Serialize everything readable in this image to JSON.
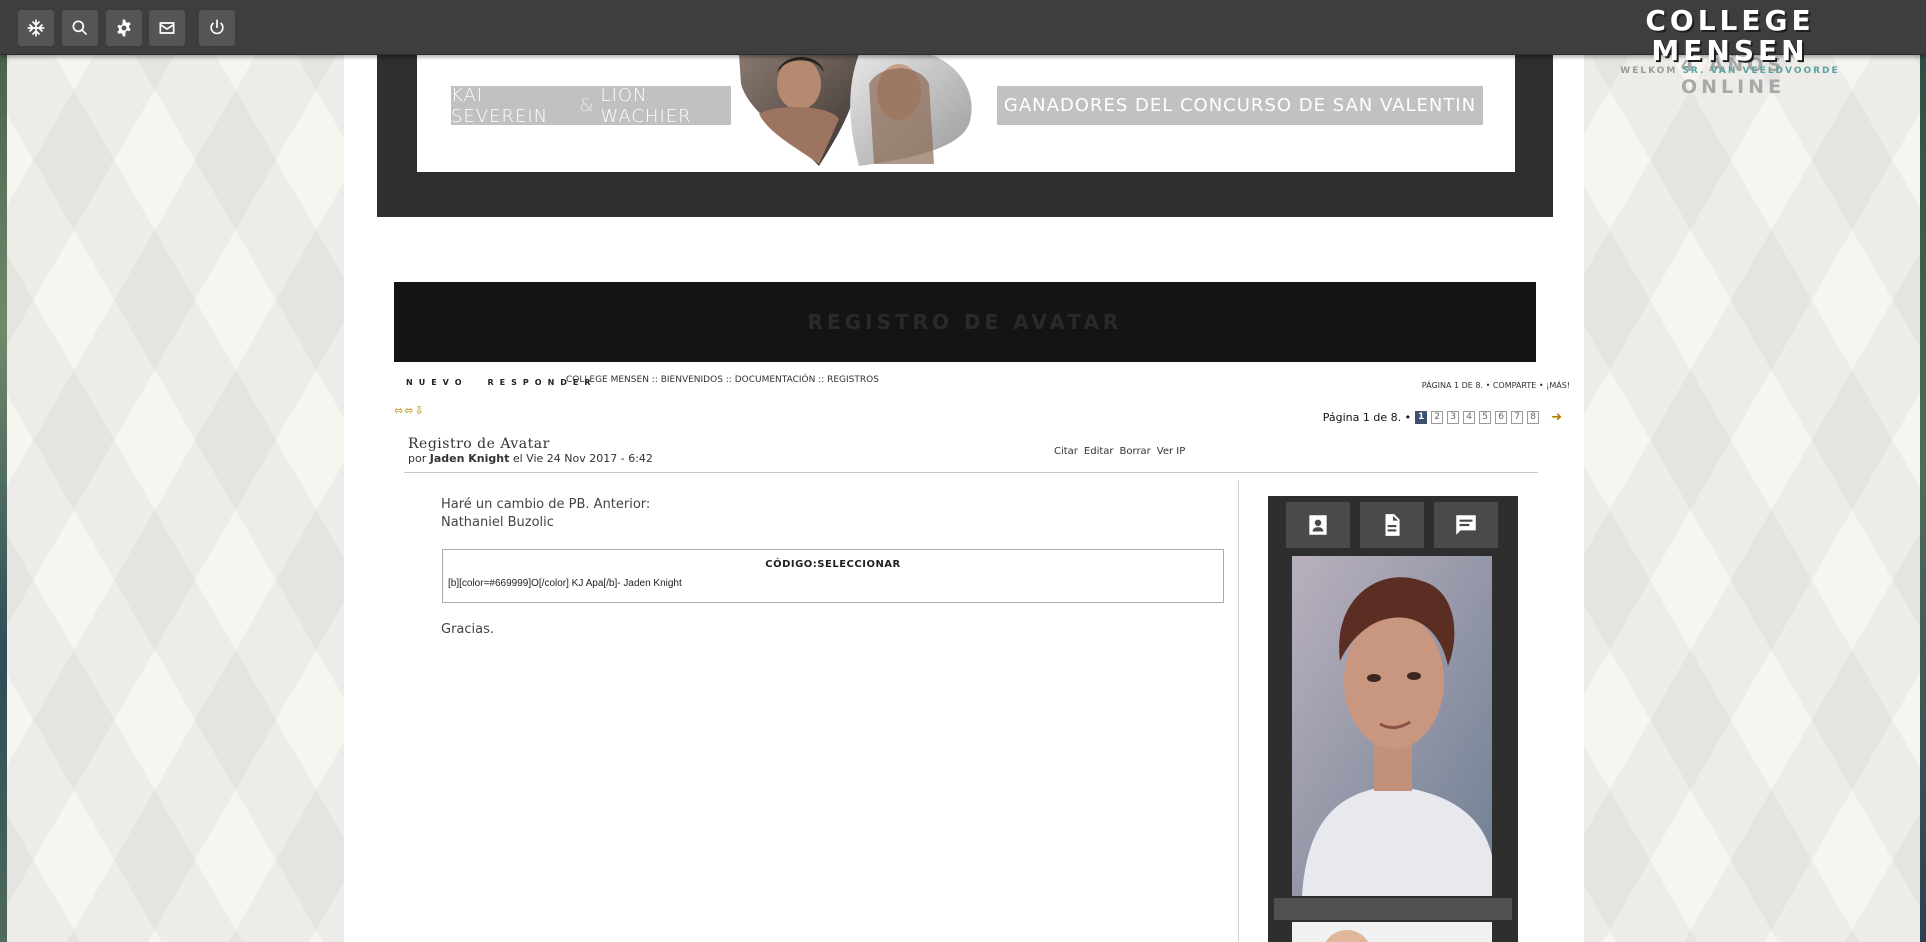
{
  "topbar": {
    "icons": [
      "snowflake-icon",
      "search-icon",
      "gear-icon",
      "mail-icon",
      "power-icon"
    ],
    "brand_title": "COLLEGE MENSEN",
    "brand_sub_prefix": "WELKOM",
    "brand_sub_name": "SR. VAN VEELDVOORDE",
    "online": "4 AÑOS ONLINE"
  },
  "banner": {
    "left_name1": "KAI SEVEREIN",
    "left_amp": "&",
    "left_name2": "LION WACHIER",
    "right_text": "GANADORES DEL CONCURSO DE SAN VALENTIN"
  },
  "topic": {
    "title": "REGISTRO DE AVATAR"
  },
  "actions": {
    "new": "NUEVO",
    "reply": "RESPONDER"
  },
  "breadcrumb": "COLLEGE MENSEN :: BIENVENIDOS :: DOCUMENTACIÓN :: REGISTROS",
  "share": "PÁGINA 1 DE 8. • COMPARTE • ¡MÁS!",
  "arrows": "⬄⬄⇩",
  "pagination": {
    "label": "Página 1 de 8. •",
    "pages": [
      "1",
      "2",
      "3",
      "4",
      "5",
      "6",
      "7",
      "8"
    ],
    "active": "1",
    "next": "➜"
  },
  "post": {
    "title": "Registro de Avatar",
    "meta_prefix": "por",
    "author": "Jaden Knight",
    "meta_date": "el Vie 24 Nov 2017 - 6:42",
    "tools": [
      "Citar",
      "Editar",
      "Borrar",
      "Ver IP"
    ],
    "body_line1": "Haré un cambio de PB. Anterior:",
    "body_line2": "Nathaniel Buzolic",
    "code_label": "CÓDIGO:SELECCIONAR",
    "code": "[b][color=#669999]O[/color] KJ Apa[/b]- Jaden Knight",
    "thanks": "Gracias."
  },
  "profile": {
    "buttons": [
      "profile-card-icon",
      "document-icon",
      "message-icon"
    ]
  },
  "colors": {
    "topbar": "#3e3e3e",
    "accent": "#5aa3a1",
    "banner_frame": "#2f2f2f",
    "title_bar": "#141414",
    "page_active": "#3d5070"
  }
}
